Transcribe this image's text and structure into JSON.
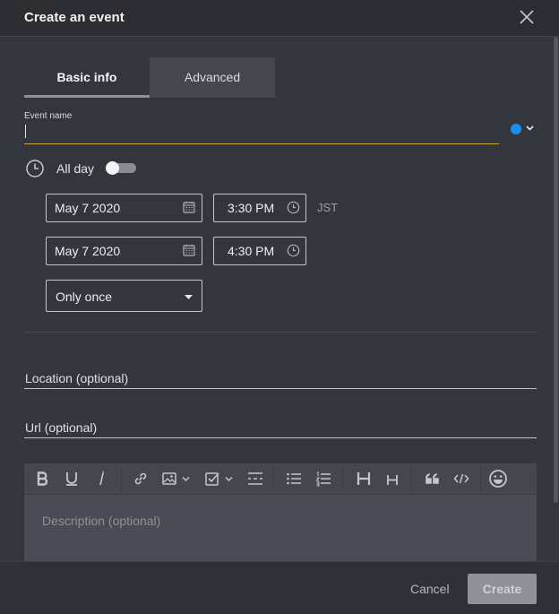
{
  "dialog": {
    "title": "Create an event"
  },
  "tabs": [
    {
      "label": "Basic info",
      "active": true
    },
    {
      "label": "Advanced",
      "active": false
    }
  ],
  "event_name": {
    "label": "Event name",
    "value": ""
  },
  "color": {
    "selected": "#1b8ff0"
  },
  "all_day": {
    "label": "All day",
    "on": false
  },
  "start": {
    "date": "May 7 2020",
    "time": "3:30 PM",
    "timezone": "JST"
  },
  "end": {
    "date": "May 7 2020",
    "time": "4:30 PM"
  },
  "repeat": {
    "value": "Only once"
  },
  "location": {
    "placeholder": "Location (optional)"
  },
  "url": {
    "placeholder": "Url (optional)"
  },
  "editor": {
    "placeholder": "Description (optional)",
    "toolbar": [
      "bold-icon",
      "underline-icon",
      "italic-icon",
      "link-icon",
      "image-icon",
      "checklist-icon",
      "divider-icon",
      "bullet-list-icon",
      "numbered-list-icon",
      "heading-large-icon",
      "heading-small-icon",
      "quote-icon",
      "code-icon",
      "emoji-icon"
    ]
  },
  "footer": {
    "cancel_label": "Cancel",
    "create_label": "Create"
  }
}
